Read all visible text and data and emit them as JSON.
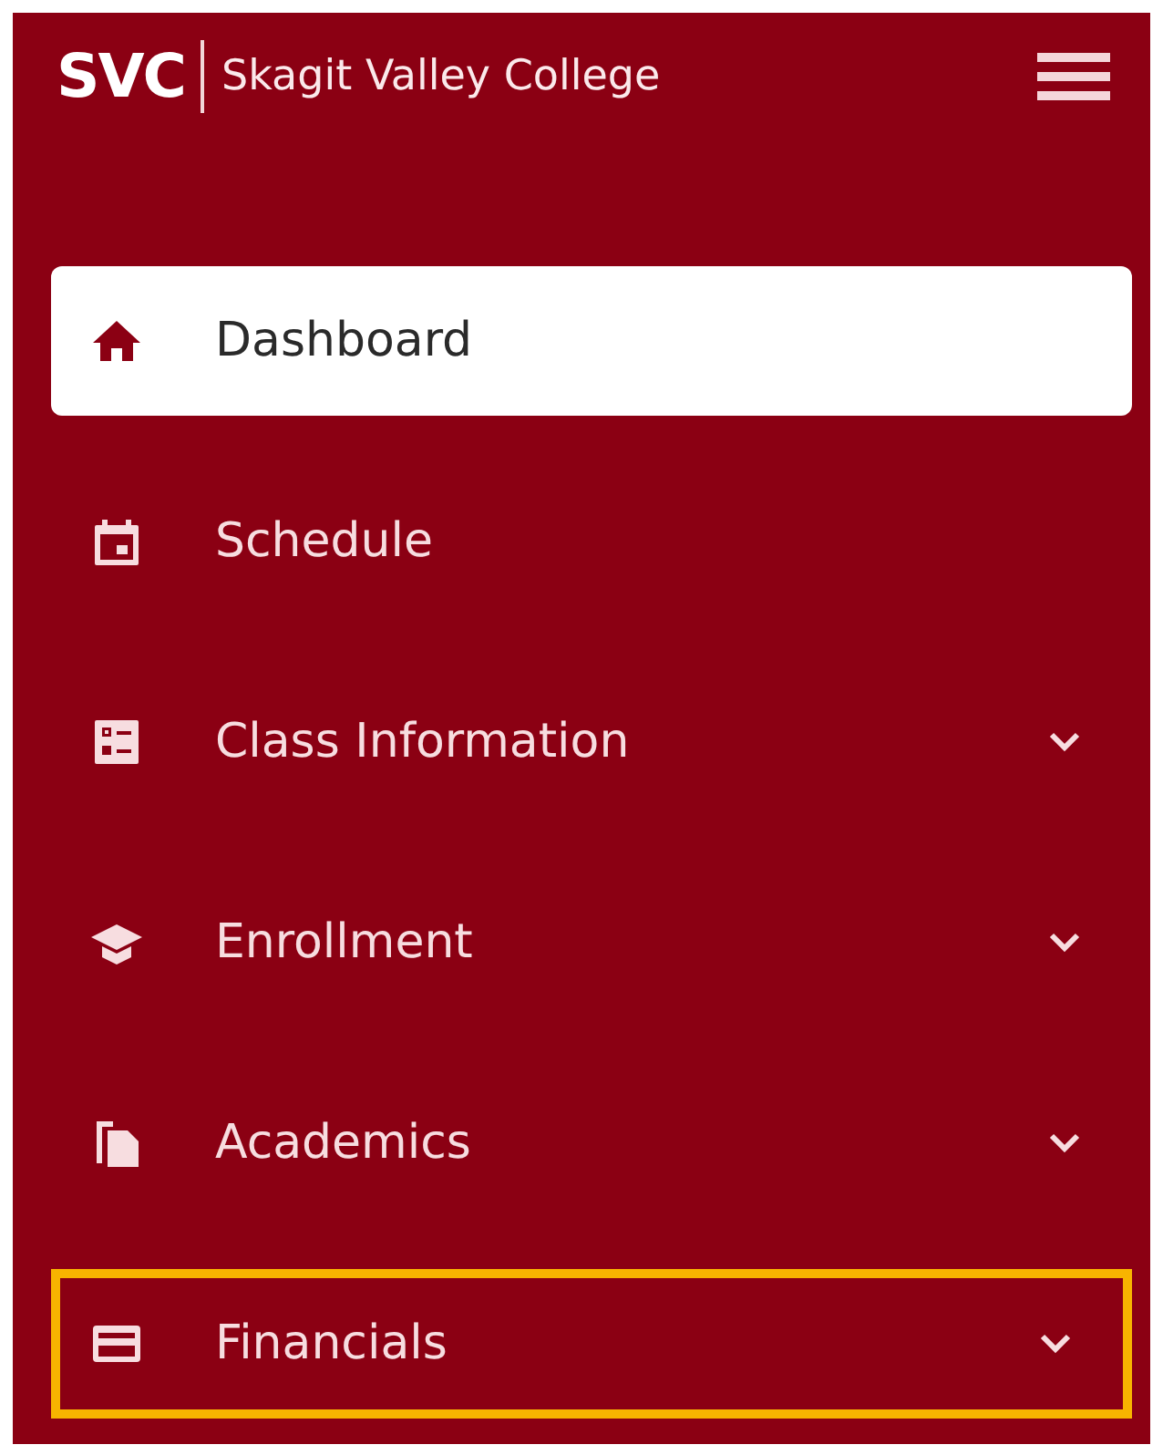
{
  "header": {
    "logo_abbr": "SVC",
    "logo_name": "Skagit Valley College"
  },
  "nav_items": [
    {
      "label": "Dashboard",
      "selected": true,
      "has_submenu": false,
      "highlighted": false
    },
    {
      "label": "Schedule",
      "selected": false,
      "has_submenu": false,
      "highlighted": false
    },
    {
      "label": "Class Information",
      "selected": false,
      "has_submenu": true,
      "highlighted": false
    },
    {
      "label": "Enrollment",
      "selected": false,
      "has_submenu": true,
      "highlighted": false
    },
    {
      "label": "Academics",
      "selected": false,
      "has_submenu": true,
      "highlighted": false
    },
    {
      "label": "Financials",
      "selected": false,
      "has_submenu": true,
      "highlighted": true
    }
  ]
}
